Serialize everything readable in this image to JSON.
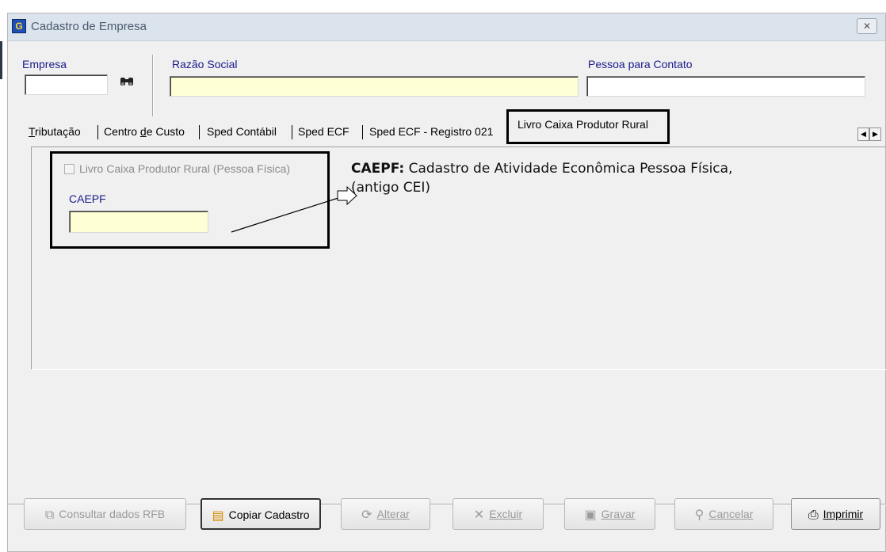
{
  "window": {
    "title": "Cadastro de Empresa",
    "close_glyph": "✕"
  },
  "header": {
    "empresa_label": "Empresa",
    "empresa_value": "",
    "razao_social_label": "Razão Social",
    "razao_social_value": "",
    "pessoa_contato_label": "Pessoa para Contato",
    "pessoa_contato_value": ""
  },
  "tabs": [
    {
      "pre": "",
      "u": "T",
      "post": "ributação"
    },
    {
      "pre": "Centro ",
      "u": "d",
      "post": "e Custo"
    },
    {
      "pre": "Sped Contábil",
      "u": "",
      "post": ""
    },
    {
      "pre": "Sped ECF",
      "u": "",
      "post": ""
    },
    {
      "pre": "Sped ECF - Registro 021",
      "u": "",
      "post": ""
    }
  ],
  "active_tab": "Livro Caixa Produtor Rural",
  "panel": {
    "checkbox_label": "Livro Caixa Produtor Rural  (Pessoa Física)",
    "caepf_label": "CAEPF",
    "caepf_value": ""
  },
  "annotation": {
    "bold": "CAEPF:",
    "line1": " Cadastro de Atividade Econômica Pessoa Física,",
    "line2": "(antigo CEI)"
  },
  "buttons": [
    {
      "label": "Consultar dados RFB",
      "icon": "copy-doc-icon",
      "underline": ""
    },
    {
      "label": "Copiar Cadastro",
      "icon": "clipboard-icon",
      "underline": ""
    },
    {
      "label": "Alterar",
      "icon": "refresh-icon",
      "underline": "A"
    },
    {
      "label": "Excluir",
      "icon": "delete-x-icon",
      "underline": "E"
    },
    {
      "label": "Gravar",
      "icon": "floppy-icon",
      "underline": "G"
    },
    {
      "label": "Cancelar",
      "icon": "cancel-run-icon",
      "underline": "C"
    },
    {
      "label": "Imprimir",
      "icon": "printer-icon",
      "underline": "I"
    }
  ]
}
